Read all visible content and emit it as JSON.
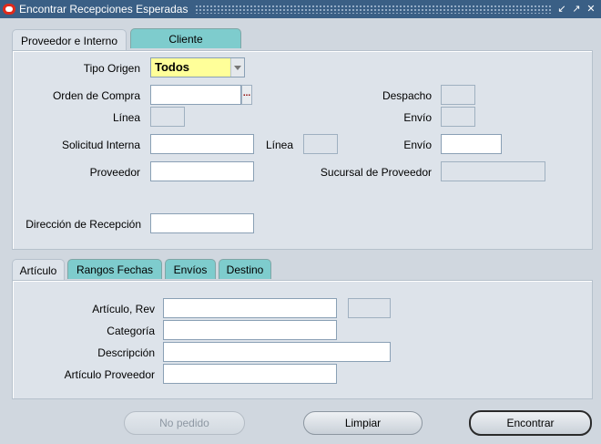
{
  "window": {
    "title": "Encontrar Recepciones Esperadas",
    "controls": [
      "minimize-icon",
      "maximize-icon",
      "close-icon"
    ]
  },
  "top_tabs": [
    {
      "label": "Proveedor e Interno",
      "active": true
    },
    {
      "label": "Cliente",
      "active": false
    }
  ],
  "header": {
    "tipo_origen_label": "Tipo Origen",
    "tipo_origen_value": "Todos",
    "orden_compra_label": "Orden de Compra",
    "orden_compra_value": "",
    "linea_label": "Línea",
    "despacho_label": "Despacho",
    "envio_label": "Envío",
    "solicitud_interna_label": "Solicitud Interna",
    "solicitud_linea_label": "Línea",
    "solicitud_envio_label": "Envío",
    "proveedor_label": "Proveedor",
    "sucursal_label": "Sucursal de Proveedor",
    "direccion_label": "Dirección de Recepción",
    "lov_glyph": "..."
  },
  "bottom_tabs": [
    {
      "label": "Artículo",
      "active": true
    },
    {
      "label": "Rangos Fechas",
      "active": false
    },
    {
      "label": "Envíos",
      "active": false
    },
    {
      "label": "Destino",
      "active": false
    }
  ],
  "item": {
    "articulo_rev_label": "Artículo, Rev",
    "categoria_label": "Categoría",
    "descripcion_label": "Descripción",
    "articulo_proveedor_label": "Artículo Proveedor"
  },
  "buttons": {
    "no_pedido": "No pedido",
    "limpiar": "Limpiar",
    "encontrar": "Encontrar"
  }
}
